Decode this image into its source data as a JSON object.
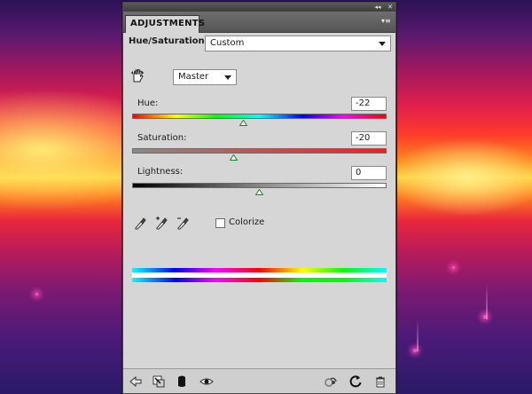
{
  "panel": {
    "tab_label": "ADJUSTMENTS",
    "title_collapse_glyph": "◂◂",
    "title_close_glyph": "✕",
    "menu_glyph": "▾≡"
  },
  "header": {
    "adjustment_name": "Hue/Saturation",
    "preset_value": "Custom"
  },
  "channel": {
    "value": "Master"
  },
  "sliders": {
    "hue": {
      "label": "Hue:",
      "value": "-22",
      "min": -180,
      "max": 180
    },
    "saturation": {
      "label": "Saturation:",
      "value": "-20",
      "min": -100,
      "max": 100
    },
    "lightness": {
      "label": "Lightness:",
      "value": "0",
      "min": -100,
      "max": 100
    }
  },
  "colorize": {
    "label": "Colorize",
    "checked": false
  },
  "icons": {
    "on_image": "hand-adjust-icon",
    "eyedroppers": [
      "eyedropper-icon",
      "eyedropper-plus-icon",
      "eyedropper-minus-icon"
    ],
    "footer_left": [
      "back-arrow-icon",
      "clip-to-layer-icon",
      "layer-mask-icon",
      "visibility-eye-icon"
    ],
    "footer_right": [
      "previous-state-icon",
      "reset-icon",
      "trash-icon"
    ]
  },
  "colors": {
    "panel_bg": "#d6d6d6",
    "thumb": "#0f8a2a"
  }
}
